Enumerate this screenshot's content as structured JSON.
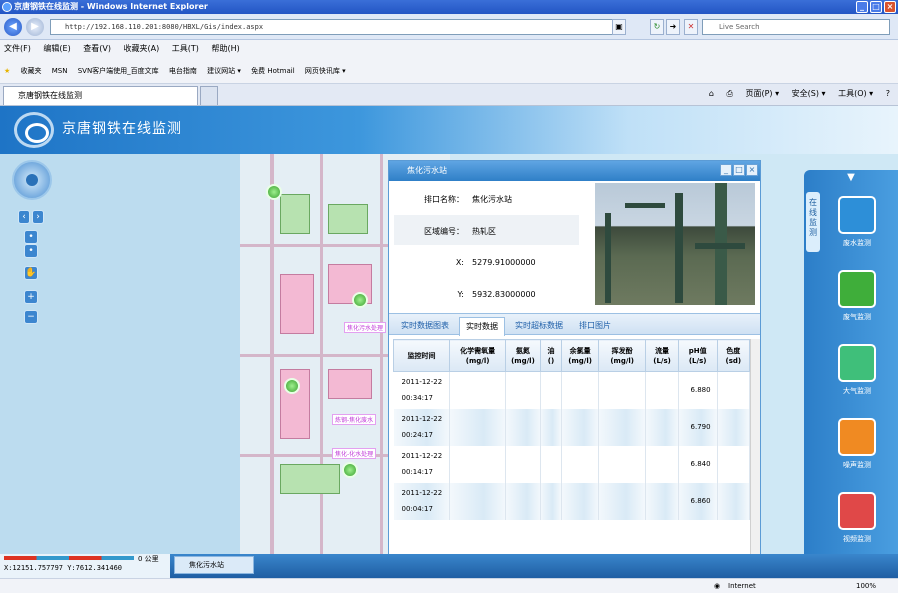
{
  "browser": {
    "window_title": "京唐钢铁在线监测 - Windows Internet Explorer",
    "url": "http://192.168.110.201:8080/HBXL/Gis/index.aspx",
    "search_placeholder": "Live Search",
    "menu": [
      "文件(F)",
      "编辑(E)",
      "查看(V)",
      "收藏夹(A)",
      "工具(T)",
      "帮助(H)"
    ],
    "favorites_label": "收藏夹",
    "favorites": [
      "MSN",
      "SVN客户端使用_百度文库",
      "电台指南",
      "建议网站 ▾",
      "免费 Hotmail",
      "网页快讯库 ▾"
    ],
    "tab_title": "京唐钢铁在线监测",
    "commands": [
      "页面(P) ▾",
      "安全(S) ▾",
      "工具(O) ▾"
    ],
    "status_zone": "Internet",
    "zoom": "100%"
  },
  "app": {
    "title": "京唐钢铁在线监测",
    "map_tags": [
      "焦化污水处理",
      "炼钢-焦化废水",
      "焦化-化水处理"
    ],
    "scale_label": "0  公里",
    "coords": "X:12151.757797  Y:7612.341460",
    "task_item": "焦化污水站"
  },
  "popup": {
    "title": "焦化污水站",
    "fields": [
      {
        "k": "排口名称：",
        "v": "焦化污水站"
      },
      {
        "k": "区域编号：",
        "v": "热轧区"
      },
      {
        "k": "X:",
        "v": "5279.91000000"
      },
      {
        "k": "Y:",
        "v": "5932.83000000"
      }
    ],
    "tabs": [
      "实时数据图表",
      "实时数据",
      "实时超标数据",
      "排口图片"
    ],
    "active_tab": 1,
    "columns": [
      [
        "监控时间",
        ""
      ],
      [
        "化学需氧量",
        "(mg/l)"
      ],
      [
        "氨氮",
        "(mg/l)"
      ],
      [
        "油",
        "()"
      ],
      [
        "余氯量",
        "(mg/l)"
      ],
      [
        "挥发酚",
        "(mg/l)"
      ],
      [
        "流量",
        "(L/s)"
      ],
      [
        "pH值",
        "(L/s)"
      ],
      [
        "色度",
        "(sd)"
      ]
    ],
    "rows": [
      {
        "date": "2011-12-22",
        "time": "00:34:17",
        "ph": "6.880"
      },
      {
        "date": "2011-12-22",
        "time": "00:24:17",
        "ph": "6.790"
      },
      {
        "date": "2011-12-22",
        "time": "00:14:17",
        "ph": "6.840"
      },
      {
        "date": "2011-12-22",
        "time": "00:04:17",
        "ph": "6.860"
      }
    ]
  },
  "side": {
    "tab_label": "在线监测",
    "items": [
      {
        "label": "废水监测",
        "icon": "water-drop-icon",
        "color": "#2d8fd8"
      },
      {
        "label": "废气监测",
        "icon": "factory-icon",
        "color": "#3fae3a"
      },
      {
        "label": "大气监测",
        "icon": "cloud-icon",
        "color": "#3fbf7a"
      },
      {
        "label": "噪声监测",
        "icon": "noise-wave-icon",
        "color": "#f08a22"
      },
      {
        "label": "视频监测",
        "icon": "camera-icon",
        "color": "#e04848"
      }
    ]
  }
}
